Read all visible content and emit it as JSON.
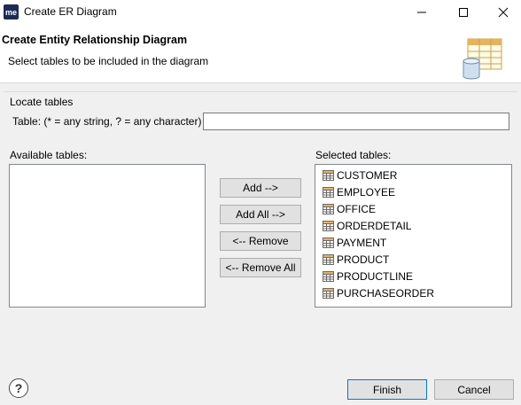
{
  "window": {
    "app_logo": "me",
    "title": "Create ER Diagram",
    "minimize_icon": "minimize-icon",
    "maximize_icon": "maximize-icon",
    "close_icon": "close-icon"
  },
  "header": {
    "title": "Create Entity Relationship Diagram",
    "subtitle": "Select tables to be included in the diagram",
    "icon": "database-table-icon"
  },
  "locate": {
    "group_label": "Locate tables",
    "field_label": "Table: (* = any string, ? = any character)",
    "value": "",
    "placeholder": ""
  },
  "available": {
    "label": "Available tables:",
    "items": []
  },
  "actions": {
    "add": "Add -->",
    "add_all": "Add All -->",
    "remove": "<-- Remove",
    "remove_all": "<-- Remove All"
  },
  "selected": {
    "label": "Selected tables:",
    "items": [
      "CUSTOMER",
      "EMPLOYEE",
      "OFFICE",
      "ORDERDETAIL",
      "PAYMENT",
      "PRODUCT",
      "PRODUCTLINE",
      "PURCHASEORDER"
    ]
  },
  "footer": {
    "help_glyph": "?",
    "finish": "Finish",
    "cancel": "Cancel"
  },
  "colors": {
    "dialog_bg": "#f0f0f0",
    "header_bg": "#ffffff",
    "button_bg": "#e1e1e1",
    "default_button_border": "#0078d7",
    "table_icon_grid": "#6a6a6a",
    "table_icon_header": "#e8b35a"
  }
}
